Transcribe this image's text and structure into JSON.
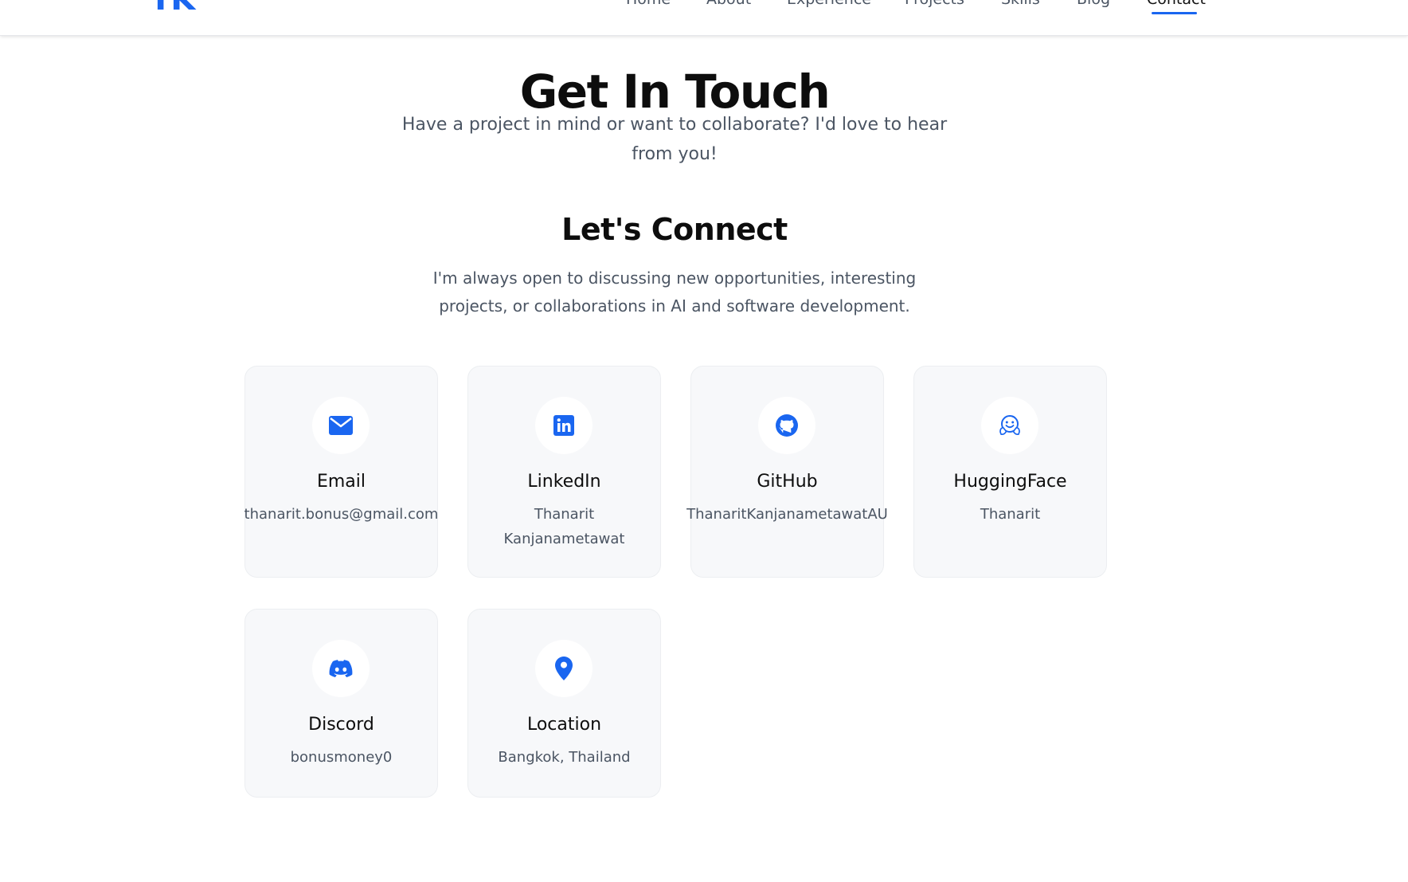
{
  "header": {
    "logo": "TK",
    "nav": [
      {
        "label": "Home",
        "active": false
      },
      {
        "label": "About",
        "active": false
      },
      {
        "label": "Experience",
        "active": false
      },
      {
        "label": "Projects",
        "active": false
      },
      {
        "label": "Skills",
        "active": false
      },
      {
        "label": "Blog",
        "active": false
      },
      {
        "label": "Contact",
        "active": true
      }
    ]
  },
  "hero": {
    "title": "Get In Touch",
    "subtitle": "Have a project in mind or want to collaborate? I'd love to hear from you!"
  },
  "connect": {
    "title": "Let's Connect",
    "text": "I'm always open to discussing new opportunities, interesting projects, or collaborations in AI and software development."
  },
  "cards": [
    {
      "icon": "envelope-icon",
      "title": "Email",
      "value": "thanarit.bonus@gmail.com"
    },
    {
      "icon": "linkedin-icon",
      "title": "LinkedIn",
      "value": "Thanarit Kanjanametawat"
    },
    {
      "icon": "github-icon",
      "title": "GitHub",
      "value": "ThanaritKanjanametawatAU"
    },
    {
      "icon": "huggingface-icon",
      "title": "HuggingFace",
      "value": "Thanarit"
    },
    {
      "icon": "discord-icon",
      "title": "Discord",
      "value": "bonusmoney0"
    },
    {
      "icon": "map-pin-icon",
      "title": "Location",
      "value": "Bangkok, Thailand"
    }
  ],
  "colors": {
    "accent": "#1a66f0",
    "card_bg": "#f7f8fa",
    "muted_text": "#4b5563"
  }
}
